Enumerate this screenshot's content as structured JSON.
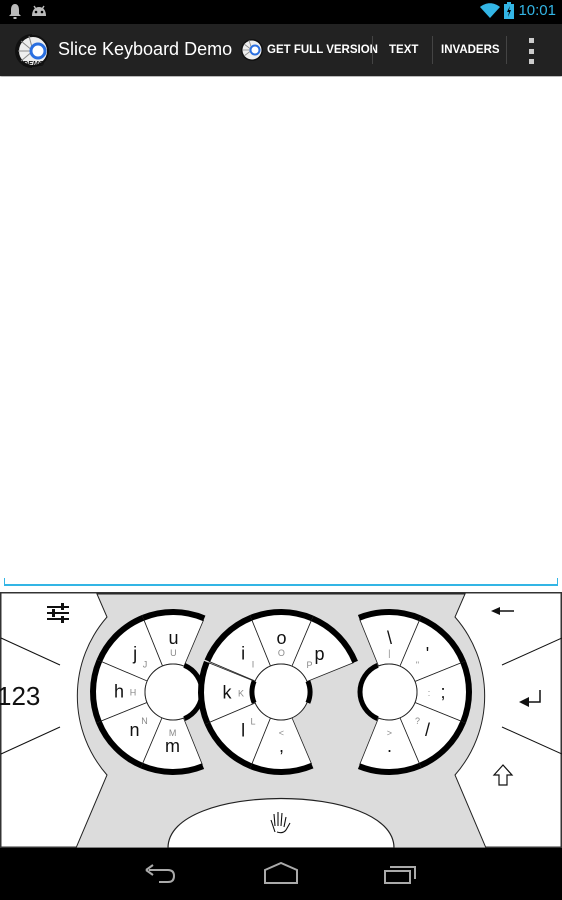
{
  "status_bar": {
    "left_icons": [
      "notification-bell-icon",
      "android-icon"
    ],
    "right_icons": [
      "wifi-icon",
      "battery-charging-icon"
    ],
    "time": "10:01"
  },
  "action_bar": {
    "title": "Slice Keyboard Demo",
    "actions": [
      {
        "label": "GET FULL VERSION",
        "icon": "slice-logo-icon"
      },
      {
        "label": "TEXT"
      },
      {
        "label": "INVADERS"
      }
    ],
    "overflow_icon": "overflow-menu-icon"
  },
  "text_area": {
    "value": ""
  },
  "keyboard": {
    "left_keys": {
      "settings": "settings-sliders-icon",
      "numbers": "123",
      "bottom": ""
    },
    "right_keys": {
      "backspace": "←",
      "enter": "↵",
      "shift": "⇧"
    },
    "rings": [
      {
        "name": "left-ring",
        "keys": [
          {
            "main": "u",
            "alt": "U"
          },
          {
            "main": "j",
            "alt": "J"
          },
          {
            "main": "h",
            "alt": "H"
          },
          {
            "main": "n",
            "alt": "N"
          },
          {
            "main": "m",
            "alt": "M"
          }
        ]
      },
      {
        "name": "middle-ring",
        "keys": [
          {
            "main": "i",
            "alt": "I"
          },
          {
            "main": "o",
            "alt": "O"
          },
          {
            "main": "p",
            "alt": "P"
          },
          {
            "main": "k",
            "alt": "K"
          },
          {
            "main": "l",
            "alt": "L"
          },
          {
            "main": ",",
            "alt": "<"
          }
        ]
      },
      {
        "name": "right-ring",
        "keys": [
          {
            "main": "\\",
            "alt": "|"
          },
          {
            "main": "'",
            "alt": "\""
          },
          {
            "main": ";",
            "alt": ":"
          },
          {
            "main": "/",
            "alt": "?"
          },
          {
            "main": ".",
            "alt": ">"
          }
        ]
      }
    ],
    "space_icon": "hand-icon"
  },
  "nav_bar": {
    "buttons": [
      "back-icon",
      "home-icon",
      "recent-apps-icon"
    ]
  }
}
